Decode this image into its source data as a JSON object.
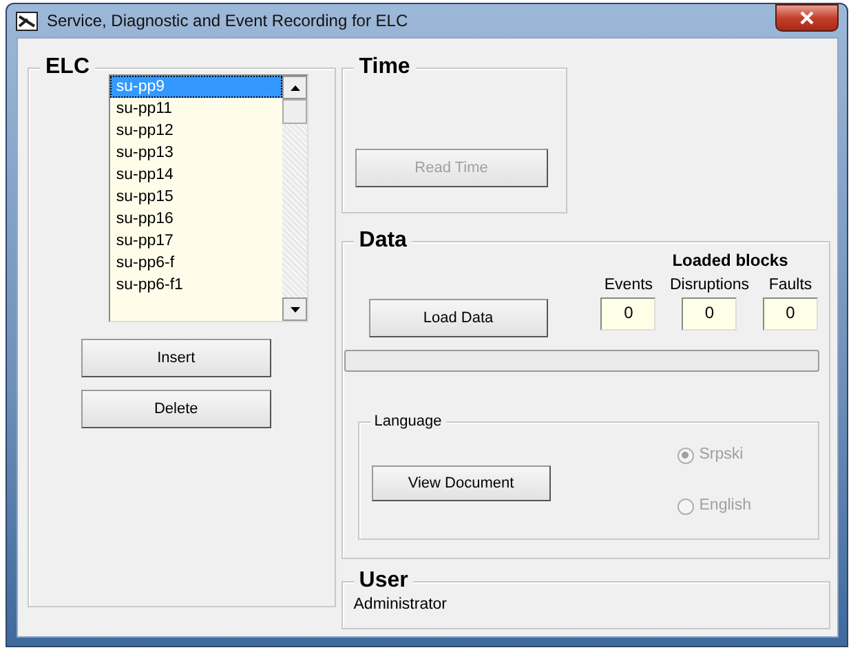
{
  "window": {
    "title": "Service, Diagnostic and Event Recording for  ELC"
  },
  "elc": {
    "title": "ELC",
    "items": [
      {
        "label": "su-pp9",
        "selected": true
      },
      {
        "label": "su-pp11",
        "selected": false
      },
      {
        "label": "su-pp12",
        "selected": false
      },
      {
        "label": "su-pp13",
        "selected": false
      },
      {
        "label": "su-pp14",
        "selected": false
      },
      {
        "label": "su-pp15",
        "selected": false
      },
      {
        "label": "su-pp16",
        "selected": false
      },
      {
        "label": "su-pp17",
        "selected": false
      },
      {
        "label": "su-pp6-f",
        "selected": false
      },
      {
        "label": "su-pp6-f1",
        "selected": false
      }
    ],
    "buttons": [
      {
        "label": "Insert",
        "disabled": false
      },
      {
        "label": "Delete",
        "disabled": false
      }
    ]
  },
  "time": {
    "title": "Time",
    "button": {
      "label": "Read Time",
      "disabled": true
    }
  },
  "data": {
    "title": "Data",
    "button": {
      "label": "Load Data",
      "disabled": false
    },
    "loaded_blocks_title": "Loaded blocks",
    "counters": [
      {
        "label": "Events",
        "value": "0"
      },
      {
        "label": "Disruptions",
        "value": "0"
      },
      {
        "label": "Faults",
        "value": "0"
      }
    ],
    "progress": {
      "level": 0
    },
    "language": {
      "title": "Language",
      "button": {
        "label": "View Document",
        "disabled": false
      },
      "options": [
        {
          "label": "Srpski",
          "selected": true,
          "disabled": true
        },
        {
          "label": "English",
          "selected": false,
          "disabled": true
        }
      ]
    }
  },
  "user": {
    "title": "User",
    "name": "Administrator"
  }
}
